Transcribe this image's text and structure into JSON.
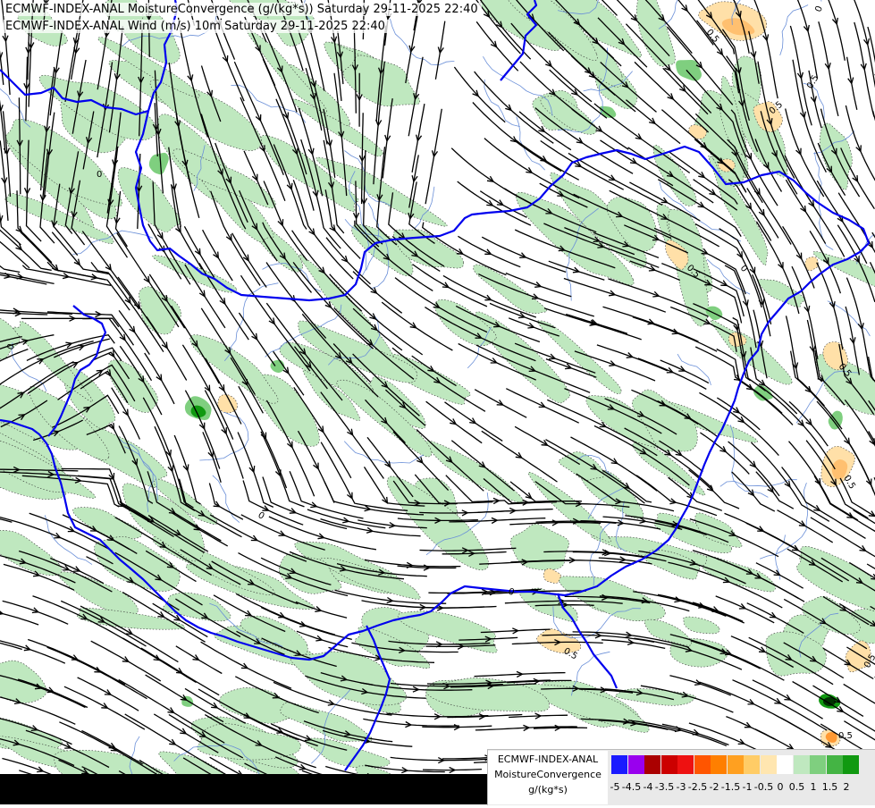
{
  "titles": {
    "line1": "ECMWF-INDEX-ANAL MoistureConvergence (g/(kg*s)) Saturday 29-11-2025 22:40",
    "line2": "ECMWF-INDEX-ANAL Wind (m/s) 10m Saturday 29-11-2025 22:40"
  },
  "legend": {
    "name": "ECMWF-INDEX-ANAL",
    "field": "MoistureConvergence",
    "unit": "g/(kg*s)",
    "ticks": [
      "-5",
      "-4.5",
      "-4",
      "-3.5",
      "-3",
      "-2.5",
      "-2",
      "-1.5",
      "-1",
      "-0.5",
      "0",
      "0.5",
      "1",
      "1.5",
      "2"
    ],
    "colors": [
      "#1a1aff",
      "#9900ee",
      "#aa0000",
      "#cc0000",
      "#ee1111",
      "#ff5500",
      "#ff7f00",
      "#ffa020",
      "#ffcc66",
      "#ffe6b0",
      "#ffffff",
      "#bfe8bf",
      "#7fcf7f",
      "#44b444",
      "#119911"
    ]
  },
  "map": {
    "colors": {
      "land": "#ffffff",
      "convergence_weak": "#bfe8bf",
      "convergence_mid": "#7fcf7f",
      "convergence_strong": "#119911",
      "divergence_weak": "#ffe0a8",
      "divergence_mid": "#ffc070",
      "border": "#0000ee",
      "river": "#6a8fd8",
      "streamline": "#000000"
    },
    "contour_labels": [
      "0",
      "0",
      "0",
      "0",
      "0",
      "0",
      "0.5",
      "0.5",
      "0.5",
      "0.5",
      "0.5",
      "0.5",
      "0.5",
      "0.5",
      "0.5"
    ]
  }
}
